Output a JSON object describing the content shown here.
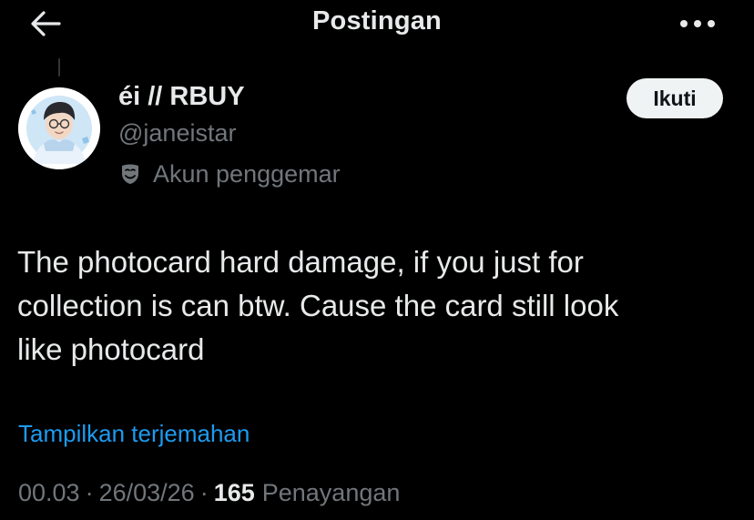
{
  "header": {
    "title": "Postingan",
    "back_icon": "arrow-left-icon",
    "more_icon": "more-horizontal-icon"
  },
  "post": {
    "author": {
      "display_name": "éi // RBUY",
      "handle": "@janeistar",
      "label_icon": "theater-mask-icon",
      "label_text": "Akun penggemar"
    },
    "follow_label": "Ikuti",
    "text": "The photocard hard damage, if you just for\ncollection is can btw. Cause the card still look\nlike photocard",
    "translate_label": "Tampilkan terjemahan",
    "time": "00.03",
    "date": "26/03/26",
    "separator": "·",
    "views_count": "165",
    "views_label": "Penayangan"
  },
  "colors": {
    "background": "#000000",
    "primary_text": "#e7e9ea",
    "secondary_text": "#71767b",
    "link": "#1d9bf0",
    "follow_button_bg": "#eff3f4"
  }
}
